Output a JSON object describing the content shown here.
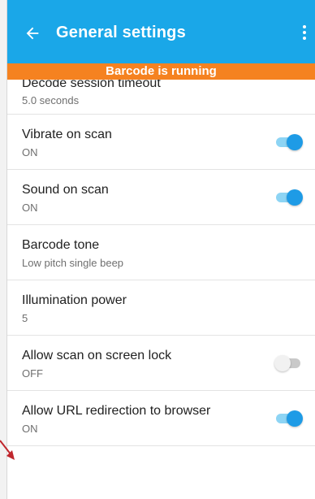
{
  "app_bar": {
    "title": "General settings",
    "back_icon": "arrow-left-icon",
    "menu_icon": "more-vertical-icon",
    "color": "#1aa7e8"
  },
  "banner": {
    "text": "Barcode is running",
    "color": "#f58220"
  },
  "settings": [
    {
      "title": "Decode session timeout",
      "value": "5.0 seconds",
      "toggle": null
    },
    {
      "title": "Vibrate on scan",
      "value": "ON",
      "toggle": "on"
    },
    {
      "title": "Sound on scan",
      "value": "ON",
      "toggle": "on"
    },
    {
      "title": "Barcode tone",
      "value": "Low pitch single beep",
      "toggle": null
    },
    {
      "title": "Illumination power",
      "value": "5",
      "toggle": null
    },
    {
      "title": "Allow scan on screen lock",
      "value": "OFF",
      "toggle": "off"
    },
    {
      "title": "Allow URL redirection to browser",
      "value": "ON",
      "toggle": "on"
    }
  ],
  "colors": {
    "toggle_on_thumb": "#1e9be6",
    "toggle_on_track": "#8dd4f4",
    "toggle_off_track": "#c9c9c9",
    "annotation_arrow": "#c0272d"
  }
}
